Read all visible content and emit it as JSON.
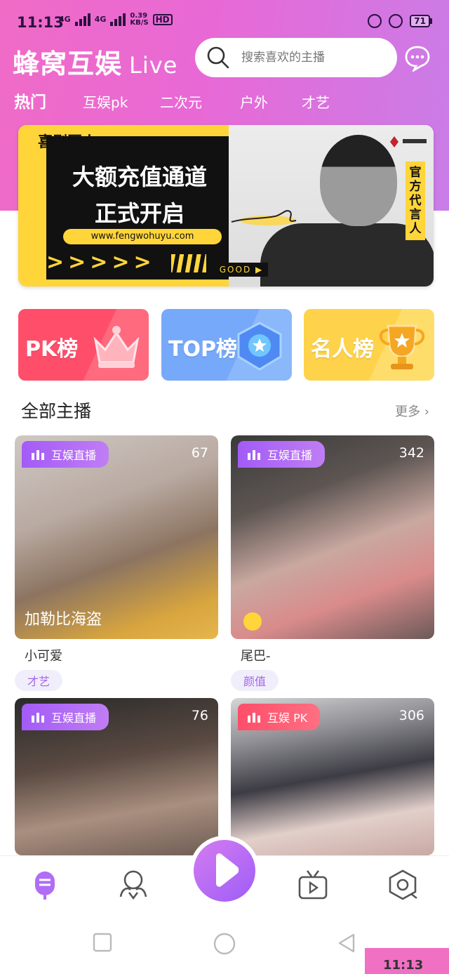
{
  "status_bar": {
    "time": "11:13",
    "network1": "4G",
    "network2": "4G",
    "speed_top": "0.39",
    "speed_bottom": "KB/S",
    "hd": "HD",
    "battery": "71"
  },
  "header": {
    "brand": "蜂窝互娱",
    "brand_suffix": "Live",
    "search_placeholder": "搜索喜欢的主播"
  },
  "tabs": [
    {
      "label": "热门",
      "active": true
    },
    {
      "label": "互娱pk",
      "active": false
    },
    {
      "label": "二次元",
      "active": false
    },
    {
      "label": "户外",
      "active": false
    },
    {
      "label": "才艺",
      "active": false
    }
  ],
  "banner": {
    "tagline": "喜剧匠人",
    "headline_line1": "大额充值通道",
    "headline_line2": "正式开启",
    "url": "www.fengwohuyu.com",
    "arrows": ">>>>>",
    "good": "GOOD ▶",
    "vertical_text": "官方代言人"
  },
  "ranks": [
    {
      "label": "PK榜",
      "color": "#ff4e6a"
    },
    {
      "label": "TOP榜",
      "color": "#76a9f9"
    },
    {
      "label": "名人榜",
      "color": "#fed24a"
    }
  ],
  "section": {
    "title": "全部主播",
    "more": "更多 ›"
  },
  "anchors": [
    {
      "live_label": "互娱直播",
      "viewers": "67",
      "overlay": "加勒比海盗",
      "name": "小可爱",
      "tag": "才艺",
      "tag_style": "purple"
    },
    {
      "live_label": "互娱直播",
      "viewers": "342",
      "overlay": "",
      "name": "尾巴-",
      "tag": "颜值",
      "tag_style": "purple"
    },
    {
      "live_label": "互娱直播",
      "viewers": "76",
      "overlay": "",
      "name": "",
      "tag": "",
      "tag_style": "purple"
    },
    {
      "live_label": "互娱 PK",
      "viewers": "306",
      "overlay": "",
      "name": "",
      "tag": "",
      "tag_style": "red"
    }
  ],
  "bottom_nav": [
    {
      "icon": "mic-icon",
      "active": true
    },
    {
      "icon": "friends-icon",
      "active": false
    },
    {
      "icon": "play-icon",
      "active": false
    },
    {
      "icon": "tv-icon",
      "active": false
    },
    {
      "icon": "hexagon-icon",
      "active": false
    }
  ],
  "pip_text": "11:13",
  "colors": {
    "brand_gradient_start": "#f06bc6",
    "brand_gradient_end": "#c97de8",
    "accent_purple": "#a35bf7",
    "pk_red": "#ff4e6a"
  }
}
